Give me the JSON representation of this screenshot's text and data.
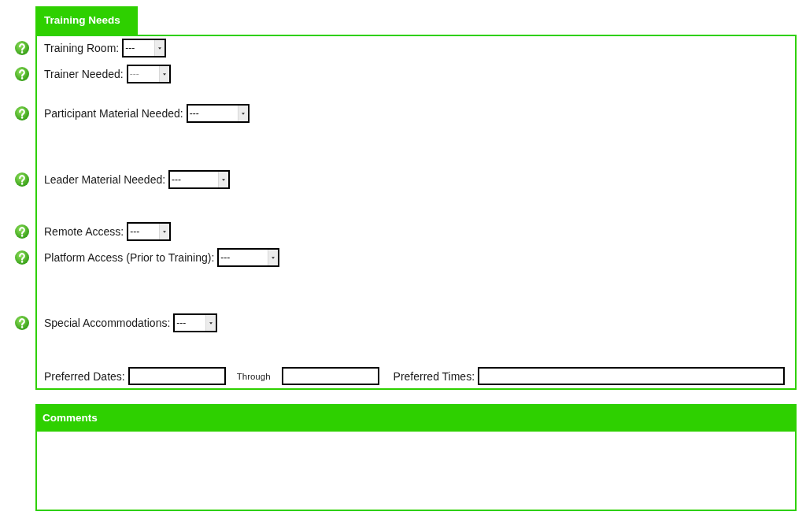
{
  "training_needs": {
    "title": "Training Needs",
    "fields": [
      {
        "label": "Training Room:",
        "value": "---",
        "disabled": false
      },
      {
        "label": "Trainer Needed:",
        "value": "---",
        "disabled": true
      },
      {
        "label": "Participant Material Needed:",
        "value": "---",
        "disabled": false
      },
      {
        "label": "Leader Material Needed:",
        "value": "---",
        "disabled": false
      },
      {
        "label": "Remote Access:",
        "value": "---",
        "disabled": false
      },
      {
        "label": "Platform Access (Prior to Training):",
        "value": "---",
        "disabled": false
      },
      {
        "label": "Special Accommodations:",
        "value": "---",
        "disabled": false
      }
    ],
    "preferred_dates": {
      "label": "Preferred Dates:",
      "separator": "Through"
    },
    "preferred_times": {
      "label": "Preferred Times:"
    }
  },
  "comments": {
    "title": "Comments"
  }
}
